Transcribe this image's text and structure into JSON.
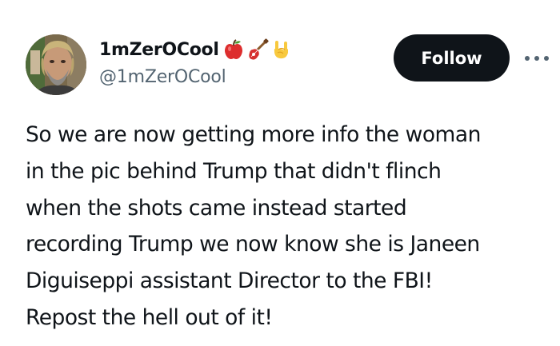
{
  "author": {
    "display_name": "1mZerOCool",
    "handle": "@1mZerOCool",
    "badges": [
      "red-apple-icon",
      "guitar-icon",
      "sign-of-the-horns-icon"
    ]
  },
  "actions": {
    "follow_label": "Follow",
    "more_icon": "more-options-icon"
  },
  "tweet": {
    "lines": [
      "So we are now getting more info the woman",
      "in the pic behind Trump that didn't flinch",
      "when the shots came instead started",
      "recording Trump we now know she is Janeen",
      "Diguiseppi assistant Director to the FBI!",
      "Repost the hell out of it!"
    ]
  },
  "colors": {
    "text_primary": "#0f1419",
    "text_secondary": "#536471",
    "follow_bg": "#0f1419",
    "follow_text": "#ffffff"
  }
}
